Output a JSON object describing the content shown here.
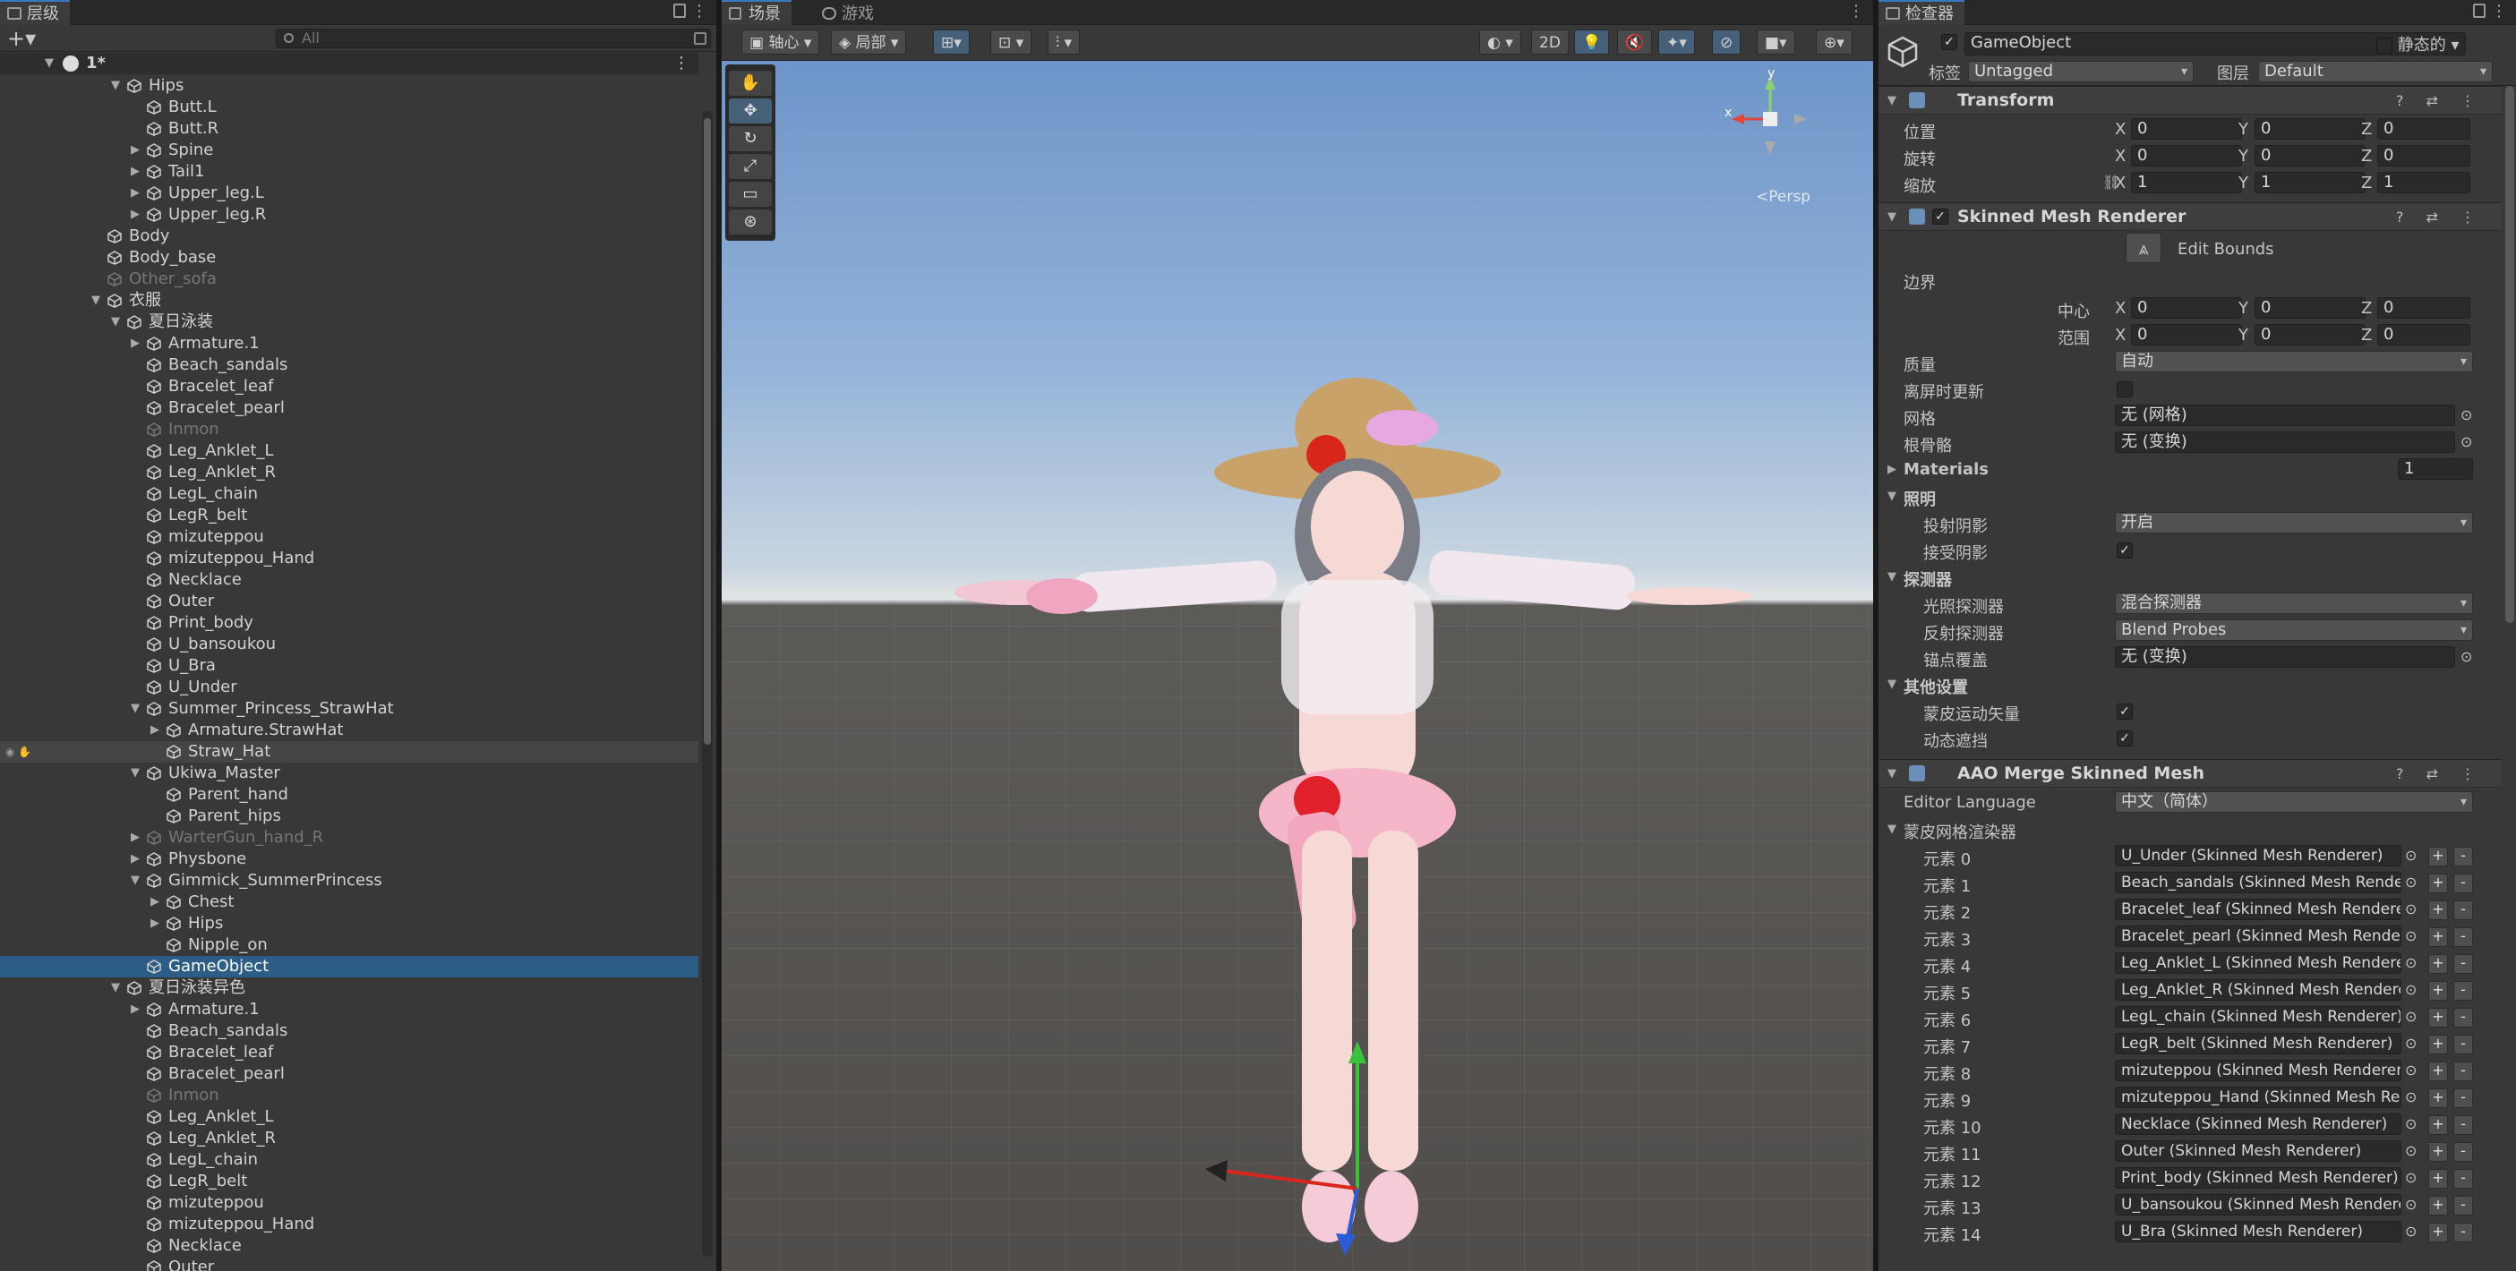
{
  "hierarchy": {
    "tab": "层级",
    "search_placeholder": "All",
    "scene_name": "1*",
    "rows": [
      {
        "label": "Hips",
        "depth": 3,
        "arrow": "▼",
        "state": ""
      },
      {
        "label": "Butt.L",
        "depth": 4,
        "arrow": "",
        "state": ""
      },
      {
        "label": "Butt.R",
        "depth": 4,
        "arrow": "",
        "state": ""
      },
      {
        "label": "Spine",
        "depth": 4,
        "arrow": "▶",
        "state": ""
      },
      {
        "label": "Tail1",
        "depth": 4,
        "arrow": "▶",
        "state": ""
      },
      {
        "label": "Upper_leg.L",
        "depth": 4,
        "arrow": "▶",
        "state": ""
      },
      {
        "label": "Upper_leg.R",
        "depth": 4,
        "arrow": "▶",
        "state": ""
      },
      {
        "label": "Body",
        "depth": 2,
        "arrow": "",
        "state": ""
      },
      {
        "label": "Body_base",
        "depth": 2,
        "arrow": "",
        "state": ""
      },
      {
        "label": "Other_sofa",
        "depth": 2,
        "arrow": "",
        "state": "dim"
      },
      {
        "label": "衣服",
        "depth": 2,
        "arrow": "▼",
        "state": ""
      },
      {
        "label": "夏日泳装",
        "depth": 3,
        "arrow": "▼",
        "state": ""
      },
      {
        "label": "Armature.1",
        "depth": 4,
        "arrow": "▶",
        "state": ""
      },
      {
        "label": "Beach_sandals",
        "depth": 4,
        "arrow": "",
        "state": ""
      },
      {
        "label": "Bracelet_leaf",
        "depth": 4,
        "arrow": "",
        "state": ""
      },
      {
        "label": "Bracelet_pearl",
        "depth": 4,
        "arrow": "",
        "state": ""
      },
      {
        "label": "Inmon",
        "depth": 4,
        "arrow": "",
        "state": "dim"
      },
      {
        "label": "Leg_Anklet_L",
        "depth": 4,
        "arrow": "",
        "state": ""
      },
      {
        "label": "Leg_Anklet_R",
        "depth": 4,
        "arrow": "",
        "state": ""
      },
      {
        "label": "LegL_chain",
        "depth": 4,
        "arrow": "",
        "state": ""
      },
      {
        "label": "LegR_belt",
        "depth": 4,
        "arrow": "",
        "state": ""
      },
      {
        "label": "mizuteppou",
        "depth": 4,
        "arrow": "",
        "state": ""
      },
      {
        "label": "mizuteppou_Hand",
        "depth": 4,
        "arrow": "",
        "state": ""
      },
      {
        "label": "Necklace",
        "depth": 4,
        "arrow": "",
        "state": ""
      },
      {
        "label": "Outer",
        "depth": 4,
        "arrow": "",
        "state": ""
      },
      {
        "label": "Print_body",
        "depth": 4,
        "arrow": "",
        "state": ""
      },
      {
        "label": "U_bansoukou",
        "depth": 4,
        "arrow": "",
        "state": ""
      },
      {
        "label": "U_Bra",
        "depth": 4,
        "arrow": "",
        "state": ""
      },
      {
        "label": "U_Under",
        "depth": 4,
        "arrow": "",
        "state": ""
      },
      {
        "label": "Summer_Princess_StrawHat",
        "depth": 4,
        "arrow": "▼",
        "state": ""
      },
      {
        "label": "Armature.StrawHat",
        "depth": 5,
        "arrow": "▶",
        "state": ""
      },
      {
        "label": "Straw_Hat",
        "depth": 5,
        "arrow": "",
        "state": "hl"
      },
      {
        "label": "Ukiwa_Master",
        "depth": 4,
        "arrow": "▼",
        "state": ""
      },
      {
        "label": "Parent_hand",
        "depth": 5,
        "arrow": "",
        "state": ""
      },
      {
        "label": "Parent_hips",
        "depth": 5,
        "arrow": "",
        "state": ""
      },
      {
        "label": "WarterGun_hand_R",
        "depth": 4,
        "arrow": "▶",
        "state": "dim"
      },
      {
        "label": "Physbone",
        "depth": 4,
        "arrow": "▶",
        "state": ""
      },
      {
        "label": "Gimmick_SummerPrincess",
        "depth": 4,
        "arrow": "▼",
        "state": ""
      },
      {
        "label": "Chest",
        "depth": 5,
        "arrow": "▶",
        "state": ""
      },
      {
        "label": "Hips",
        "depth": 5,
        "arrow": "▶",
        "state": ""
      },
      {
        "label": "Nipple_on",
        "depth": 5,
        "arrow": "",
        "state": ""
      },
      {
        "label": "GameObject",
        "depth": 4,
        "arrow": "",
        "state": "sel"
      },
      {
        "label": "夏日泳装异色",
        "depth": 3,
        "arrow": "▼",
        "state": ""
      },
      {
        "label": "Armature.1",
        "depth": 4,
        "arrow": "▶",
        "state": ""
      },
      {
        "label": "Beach_sandals",
        "depth": 4,
        "arrow": "",
        "state": ""
      },
      {
        "label": "Bracelet_leaf",
        "depth": 4,
        "arrow": "",
        "state": ""
      },
      {
        "label": "Bracelet_pearl",
        "depth": 4,
        "arrow": "",
        "state": ""
      },
      {
        "label": "Inmon",
        "depth": 4,
        "arrow": "",
        "state": "dim"
      },
      {
        "label": "Leg_Anklet_L",
        "depth": 4,
        "arrow": "",
        "state": ""
      },
      {
        "label": "Leg_Anklet_R",
        "depth": 4,
        "arrow": "",
        "state": ""
      },
      {
        "label": "LegL_chain",
        "depth": 4,
        "arrow": "",
        "state": ""
      },
      {
        "label": "LegR_belt",
        "depth": 4,
        "arrow": "",
        "state": ""
      },
      {
        "label": "mizuteppou",
        "depth": 4,
        "arrow": "",
        "state": ""
      },
      {
        "label": "mizuteppou_Hand",
        "depth": 4,
        "arrow": "",
        "state": ""
      },
      {
        "label": "Necklace",
        "depth": 4,
        "arrow": "",
        "state": ""
      },
      {
        "label": "Outer",
        "depth": 4,
        "arrow": "",
        "state": ""
      }
    ]
  },
  "scene": {
    "tab_scene": "场景",
    "tab_game": "游戏",
    "pivot": "轴心",
    "local": "局部",
    "btn_2d": "2D",
    "persp": "<Persp",
    "axis_y": "y",
    "axis_x": "x"
  },
  "inspector": {
    "tab": "检查器",
    "object_name": "GameObject",
    "static_label": "静态的",
    "tag_label": "标签",
    "tag_value": "Untagged",
    "layer_label": "图层",
    "layer_value": "Default",
    "transform": {
      "title": "Transform",
      "pos": "位置",
      "rot": "旋转",
      "scale": "缩放",
      "pos_v": [
        "0",
        "0",
        "0"
      ],
      "rot_v": [
        "0",
        "0",
        "0"
      ],
      "scale_v": [
        "1",
        "1",
        "1"
      ]
    },
    "smr": {
      "title": "Skinned Mesh Renderer",
      "edit_bounds": "Edit Bounds",
      "bounds": "边界",
      "center": "中心",
      "extent": "范围",
      "center_v": [
        "0",
        "0",
        "0"
      ],
      "extent_v": [
        "0",
        "0",
        "0"
      ],
      "quality": "质量",
      "quality_v": "自动",
      "offscreen": "离屏时更新",
      "mesh": "网格",
      "mesh_v": "无 (网格)",
      "rootbone": "根骨骼",
      "rootbone_v": "无 (变换)",
      "materials": "Materials",
      "materials_count": "1",
      "lighting": "照明",
      "cast": "投射阴影",
      "cast_v": "开启",
      "receive": "接受阴影",
      "probes": "探测器",
      "light_probe": "光照探测器",
      "light_probe_v": "混合探测器",
      "refl_probe": "反射探测器",
      "refl_probe_v": "Blend Probes",
      "anchor": "锚点覆盖",
      "anchor_v": "无 (变换)",
      "other": "其他设置",
      "skin_mv": "蒙皮运动矢量",
      "dyn_occ": "动态遮挡"
    },
    "aao": {
      "title": "AAO Merge Skinned Mesh",
      "lang_label": "Editor Language",
      "lang_v": "中文（简体）",
      "renderers": "蒙皮网格渲染器",
      "elements": [
        {
          "k": "元素 0",
          "v": "U_Under (Skinned Mesh Renderer)"
        },
        {
          "k": "元素 1",
          "v": "Beach_sandals (Skinned Mesh Renderer)"
        },
        {
          "k": "元素 2",
          "v": "Bracelet_leaf (Skinned Mesh Renderer)"
        },
        {
          "k": "元素 3",
          "v": "Bracelet_pearl (Skinned Mesh Renderer)"
        },
        {
          "k": "元素 4",
          "v": "Leg_Anklet_L (Skinned Mesh Renderer)"
        },
        {
          "k": "元素 5",
          "v": "Leg_Anklet_R (Skinned Mesh Renderer)"
        },
        {
          "k": "元素 6",
          "v": "LegL_chain (Skinned Mesh Renderer)"
        },
        {
          "k": "元素 7",
          "v": "LegR_belt (Skinned Mesh Renderer)"
        },
        {
          "k": "元素 8",
          "v": "mizuteppou (Skinned Mesh Renderer)"
        },
        {
          "k": "元素 9",
          "v": "mizuteppou_Hand (Skinned Mesh Renderer)"
        },
        {
          "k": "元素 10",
          "v": "Necklace (Skinned Mesh Renderer)"
        },
        {
          "k": "元素 11",
          "v": "Outer (Skinned Mesh Renderer)"
        },
        {
          "k": "元素 12",
          "v": "Print_body (Skinned Mesh Renderer)"
        },
        {
          "k": "元素 13",
          "v": "U_bansoukou (Skinned Mesh Renderer)"
        },
        {
          "k": "元素 14",
          "v": "U_Bra (Skinned Mesh Renderer)"
        }
      ]
    }
  },
  "colors": {
    "selection": "#2c5d87",
    "panel": "#383838",
    "accent": "#3a79bb"
  }
}
